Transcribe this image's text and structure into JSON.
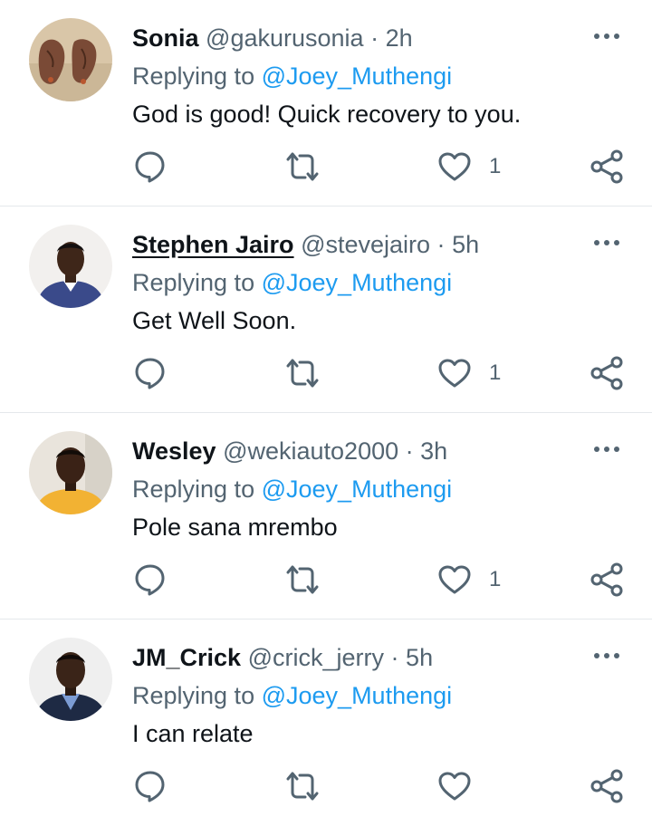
{
  "tweets": [
    {
      "name": "Sonia",
      "handle": "@gakurusonia",
      "separator": "·",
      "time": "2h",
      "replying_prefix": "Replying to",
      "replying_to": "@Joey_Muthengi",
      "text": "God is good! Quick recovery to you.",
      "like_count": "1",
      "avatar": "avatar-hennaed-feet"
    },
    {
      "name": "Stephen Jairo",
      "handle": "@stevejairo",
      "separator": "·",
      "time": "5h",
      "replying_prefix": "Replying to",
      "replying_to": "@Joey_Muthengi",
      "text": "Get Well Soon.",
      "like_count": "1",
      "avatar": "avatar-man-blue-shirt"
    },
    {
      "name": "Wesley",
      "handle": "@wekiauto2000",
      "separator": "·",
      "time": "3h",
      "replying_prefix": "Replying to",
      "replying_to": "@Joey_Muthengi",
      "text": "Pole sana mrembo",
      "like_count": "1",
      "avatar": "avatar-man-yellow-shirt"
    },
    {
      "name": "JM_Crick",
      "handle": "@crick_jerry",
      "separator": "·",
      "time": "5h",
      "replying_prefix": "Replying to",
      "replying_to": "@Joey_Muthengi",
      "text": "I can relate",
      "like_count": "",
      "avatar": "avatar-man-suit"
    }
  ],
  "icons": {
    "more": "more-dots-icon",
    "reply": "reply-bubble-icon",
    "retweet": "retweet-icon",
    "like": "heart-icon",
    "share": "share-icon"
  },
  "colors": {
    "text": "#0f1419",
    "secondary": "#536471",
    "link": "#1d9bf0",
    "divider": "#e4e8eb"
  }
}
